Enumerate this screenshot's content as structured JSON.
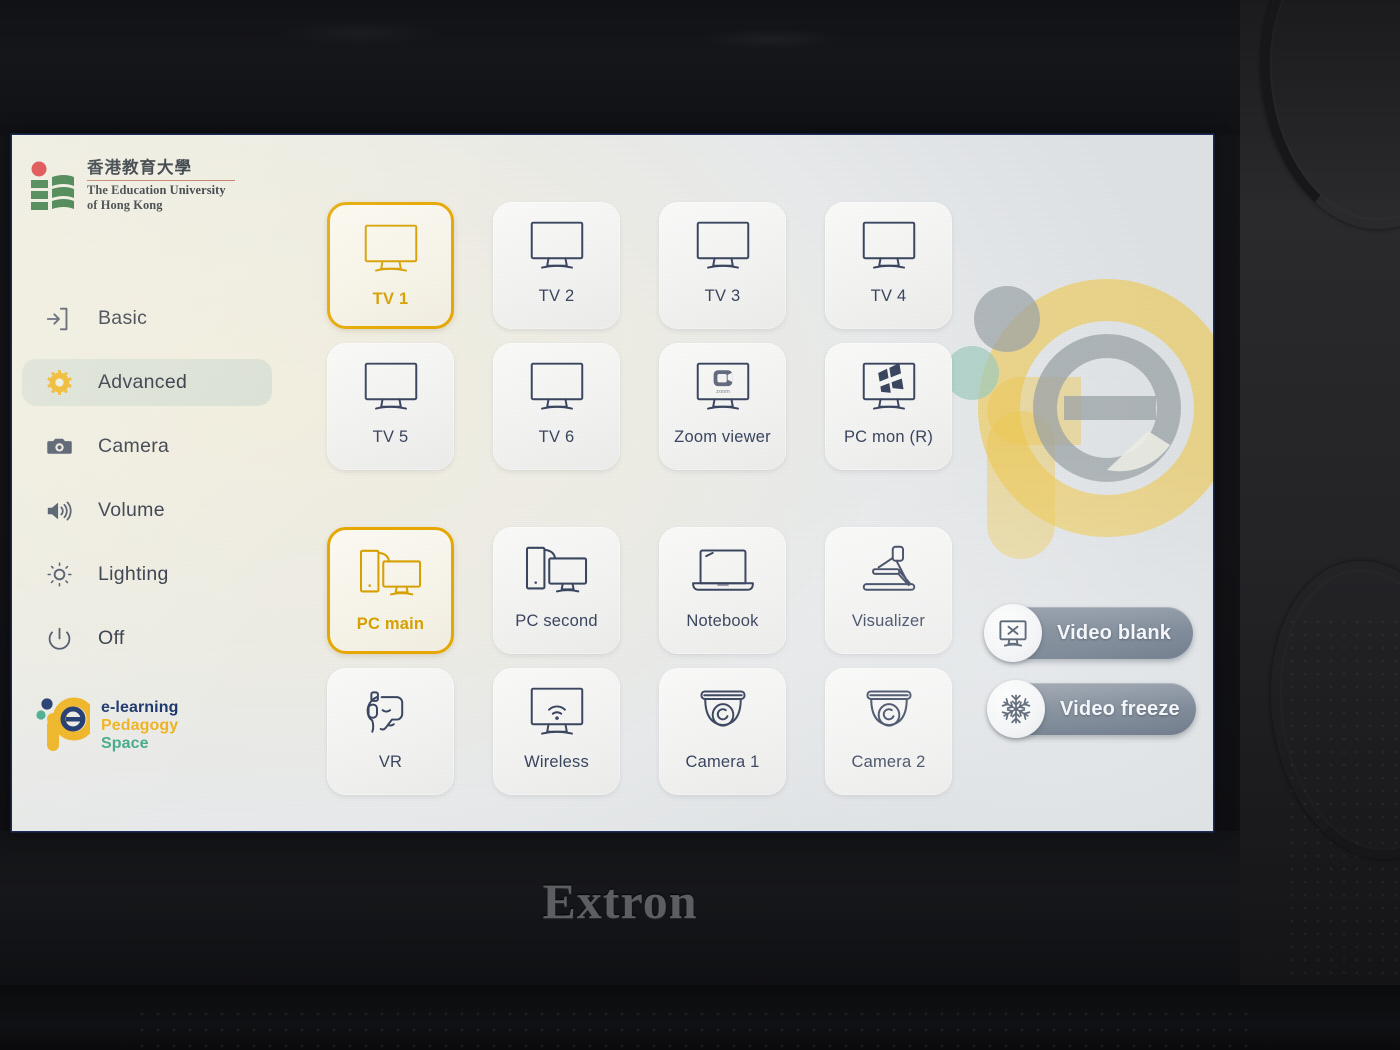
{
  "device": {
    "brand": "Extron"
  },
  "sidebar": {
    "university": {
      "name_zh": "香港教育大學",
      "name_en_line1": "The Education University",
      "name_en_line2": "of Hong Kong"
    },
    "items": [
      {
        "label": "Basic",
        "icon": "login-arrow-icon",
        "active": false
      },
      {
        "label": "Advanced",
        "icon": "gear-icon",
        "active": true
      },
      {
        "label": "Camera",
        "icon": "camera-icon",
        "active": false
      },
      {
        "label": "Volume",
        "icon": "speaker-icon",
        "active": false
      },
      {
        "label": "Lighting",
        "icon": "brightness-icon",
        "active": false
      },
      {
        "label": "Off",
        "icon": "power-icon",
        "active": false
      }
    ],
    "elearning_logo": {
      "line1": "e-learning",
      "line2": "Pedagogy",
      "line3": "Space"
    }
  },
  "main": {
    "sources": [
      {
        "label": "TV 1",
        "icon": "monitor-icon",
        "selected": true,
        "row": 0,
        "col": 0
      },
      {
        "label": "TV 2",
        "icon": "monitor-icon",
        "selected": false,
        "row": 0,
        "col": 1
      },
      {
        "label": "TV 3",
        "icon": "monitor-icon",
        "selected": false,
        "row": 0,
        "col": 2
      },
      {
        "label": "TV 4",
        "icon": "monitor-icon",
        "selected": false,
        "row": 0,
        "col": 3
      },
      {
        "label": "TV 5",
        "icon": "monitor-icon",
        "selected": false,
        "row": 1,
        "col": 0
      },
      {
        "label": "TV 6",
        "icon": "monitor-icon",
        "selected": false,
        "row": 1,
        "col": 1
      },
      {
        "label": "Zoom viewer",
        "icon": "zoom-monitor-icon",
        "selected": false,
        "row": 1,
        "col": 2
      },
      {
        "label": "PC mon (R)",
        "icon": "windows-monitor-icon",
        "selected": false,
        "row": 1,
        "col": 3
      },
      {
        "label": "PC main",
        "icon": "desktop-pc-icon",
        "selected": true,
        "row": 2,
        "col": 0
      },
      {
        "label": "PC second",
        "icon": "desktop-pc-icon",
        "selected": false,
        "row": 2,
        "col": 1
      },
      {
        "label": "Notebook",
        "icon": "laptop-icon",
        "selected": false,
        "row": 2,
        "col": 2
      },
      {
        "label": "Visualizer",
        "icon": "visualizer-icon",
        "selected": false,
        "row": 2,
        "col": 3
      },
      {
        "label": "VR",
        "icon": "vr-headset-icon",
        "selected": false,
        "row": 3,
        "col": 0
      },
      {
        "label": "Wireless",
        "icon": "wifi-monitor-icon",
        "selected": false,
        "row": 3,
        "col": 1
      },
      {
        "label": "Camera 1",
        "icon": "dome-camera-icon",
        "selected": false,
        "row": 3,
        "col": 2
      },
      {
        "label": "Camera 2",
        "icon": "dome-camera-icon",
        "selected": false,
        "row": 3,
        "col": 3
      }
    ],
    "actions": [
      {
        "label": "Video blank",
        "icon": "screen-blank-icon"
      },
      {
        "label": "Video freeze",
        "icon": "snowflake-icon"
      }
    ]
  },
  "colors": {
    "accent_gold": "#e8a900",
    "icon_navy": "#3b4660",
    "pill_slate": "#6d7b8c",
    "eduhk_green": "#1f6b32",
    "eduhk_red": "#d9232e"
  }
}
